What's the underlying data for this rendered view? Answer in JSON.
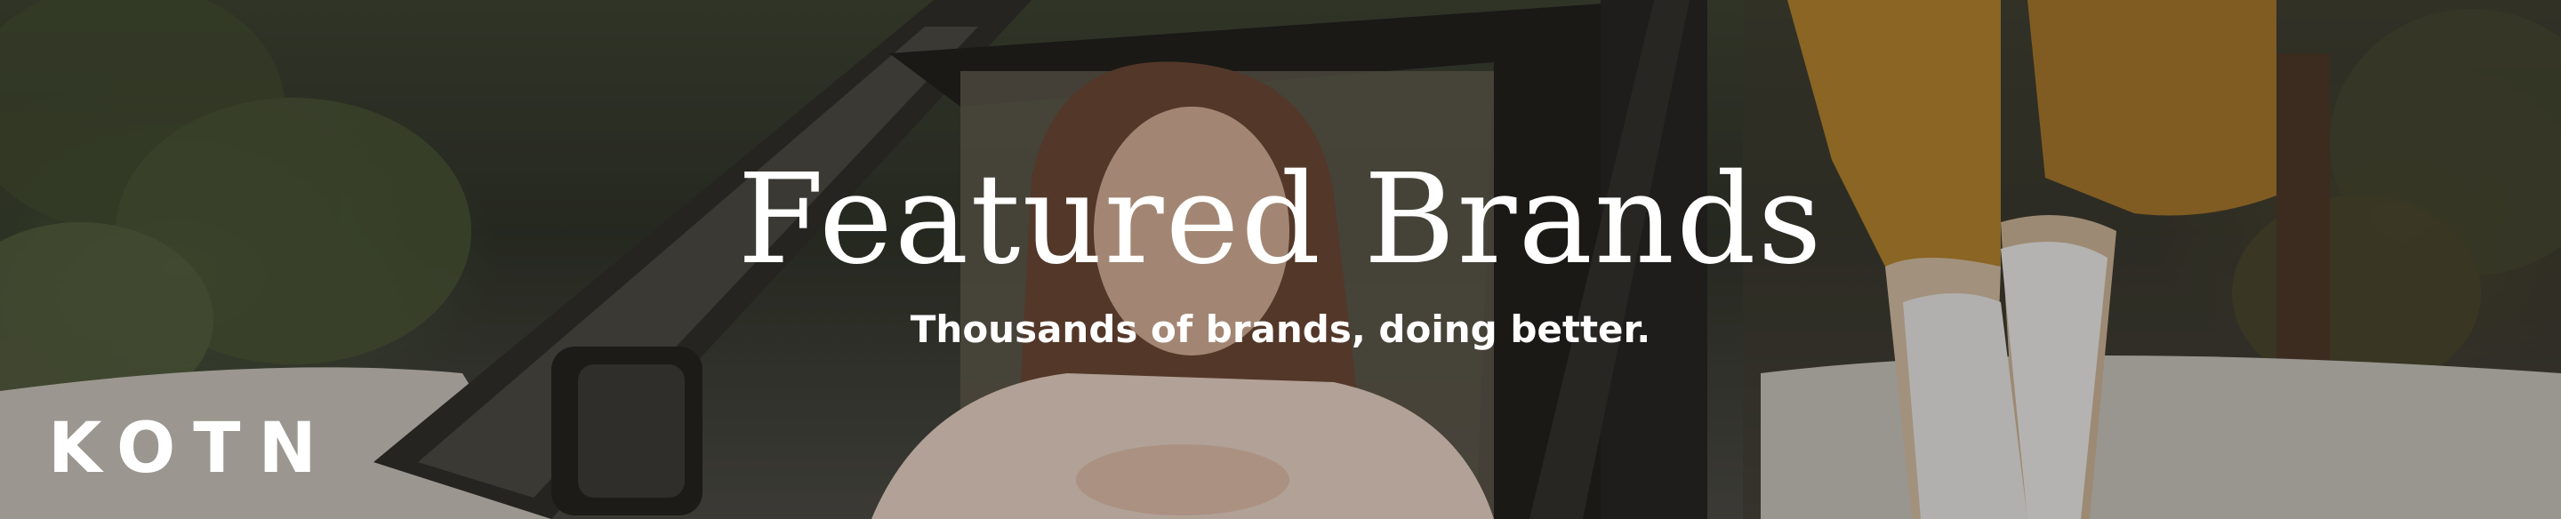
{
  "banner": {
    "title": "Featured Brands",
    "subtitle": "Thousands of brands, doing better.",
    "logo": "KOTN"
  },
  "colors": {
    "text": "#ffffff",
    "foliage": "#3b4231",
    "car_body": "#c8c4bc",
    "mustard_pants": "#b8862c",
    "sweater": "#efd9cc"
  }
}
